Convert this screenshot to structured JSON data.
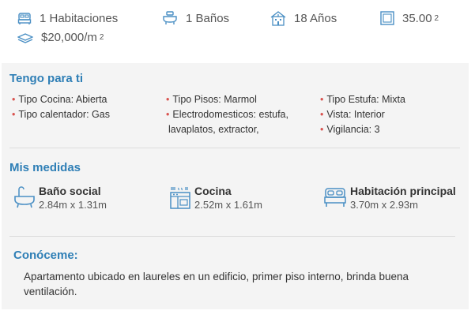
{
  "summary": {
    "bedrooms": "1 Habitaciones",
    "bathrooms": "1 Baños",
    "age": "18 Años",
    "area_value": "35.00",
    "area_sup": "2",
    "price_m2": "$20,000/m",
    "price_sup": "2"
  },
  "features": {
    "title": "Tengo para ti",
    "items": [
      "Tipo Cocina: Abierta",
      "Tipo calentador: Gas",
      "Tipo Pisos: Marmol",
      "Electrodomesticos: estufa,",
      "lavaplatos, extractor,",
      "Tipo Estufa: Mixta",
      "Vista: Interior",
      "Vigilancia: 3"
    ]
  },
  "measures": {
    "title": "Mis medidas",
    "items": [
      {
        "name": "Baño social",
        "value": "2.84m x 1.31m"
      },
      {
        "name": "Cocina",
        "value": "2.52m x 1.61m"
      },
      {
        "name": "Habitación principal",
        "value": "3.70m x 2.93m"
      }
    ]
  },
  "about": {
    "title": "Conóceme:",
    "text": "Apartamento ubicado en laureles en un edificio, primer piso interno, brinda buena ventilación."
  },
  "colors": {
    "accent": "#2f7fb6",
    "bullet": "#d9534f",
    "icon": "#4a8fc4",
    "panel": "#f4f4f4"
  },
  "icons": [
    "bed-icon",
    "bath-icon",
    "building-icon",
    "area-icon",
    "layers-icon",
    "bathtub-icon",
    "kitchen-icon",
    "bed-large-icon"
  ]
}
